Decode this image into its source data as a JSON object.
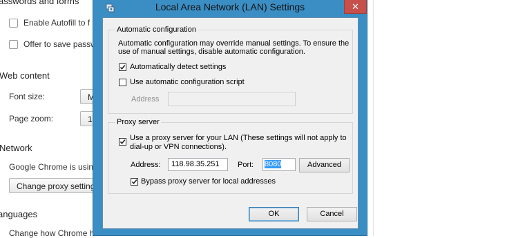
{
  "background": {
    "passwords_heading": "asswords and forms",
    "autofill_label": "Enable Autofill to f",
    "offer_save_label": "Offer to save passw",
    "web_content_heading": "Web content",
    "font_size_label": "Font size:",
    "font_size_value": "M",
    "page_zoom_label": "Page zoom:",
    "page_zoom_value": "1",
    "network_heading": "Network",
    "network_desc": "Google Chrome is usin",
    "change_proxy_label": "Change proxy setting",
    "languages_heading": "anguages",
    "languages_desc": "Change how Chrome h"
  },
  "dialog": {
    "title": "Local Area Network (LAN) Settings",
    "close_glyph": "✕",
    "auto_config": {
      "label": "Automatic configuration",
      "description_line1": "Automatic configuration may override manual settings.  To ensure the",
      "description_line2": "use of manual settings, disable automatic configuration.",
      "auto_detect_label": "Automatically detect settings",
      "auto_detect_checked": true,
      "use_script_label": "Use automatic configuration script",
      "use_script_checked": false,
      "address_label": "Address",
      "address_value": ""
    },
    "proxy": {
      "label": "Proxy server",
      "use_proxy_line1": "Use a proxy server for your LAN (These settings will not apply to",
      "use_proxy_line2": "dial-up or VPN connections).",
      "use_proxy_checked": true,
      "address_label": "Address:",
      "address_value": "118.98.35.251",
      "port_label": "Port:",
      "port_value": "8080",
      "advanced_label": "Advanced",
      "bypass_label": "Bypass proxy server for local addresses",
      "bypass_checked": true
    },
    "ok_label": "OK",
    "cancel_label": "Cancel"
  },
  "colors": {
    "window_frame": "#3a8ec4",
    "close_button": "#c7504a",
    "selection": "#3399ff"
  }
}
